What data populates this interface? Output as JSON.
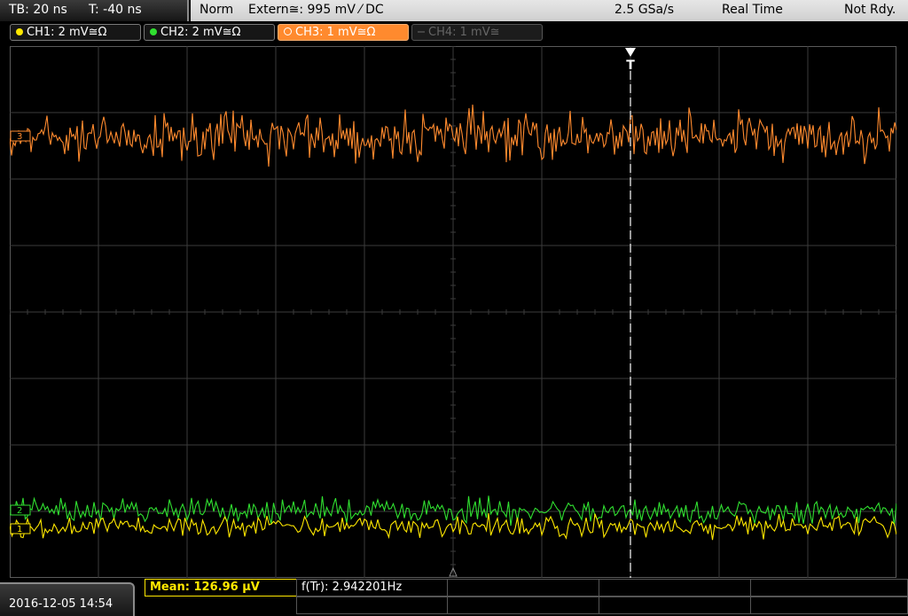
{
  "status": {
    "timebase": "TB: 20 ns",
    "trigger_time": "T: -40 ns",
    "mode": "Norm",
    "trigger_source": "Extern≅: 995 mV ⁄ DC",
    "sample_rate": "2.5 GSa/s",
    "acq_mode": "Real Time",
    "state": "Not Rdy."
  },
  "channels": [
    {
      "label": "CH1: 2 mV≅Ω",
      "color": "#ffe800"
    },
    {
      "label": "CH2: 2 mV≅Ω",
      "color": "#30e030"
    },
    {
      "label": "CH3: 1 mV≅Ω",
      "color": "#ff8a2e"
    },
    {
      "label": "CH4: 1 mV≅",
      "color": "#555555"
    }
  ],
  "markers": {
    "trigger": "T",
    "ch1": "1",
    "ch2": "2",
    "ch3": "3"
  },
  "bottom": {
    "datetime": "2016-12-05 14:54",
    "mean": "Mean: 126.96 µV",
    "freq": "f(Tr): 2.942201Hz"
  },
  "colors": {
    "grid": "#3c3c3c",
    "ch1": "#ffe800",
    "ch2": "#30e030",
    "ch3": "#ff8a2e"
  }
}
